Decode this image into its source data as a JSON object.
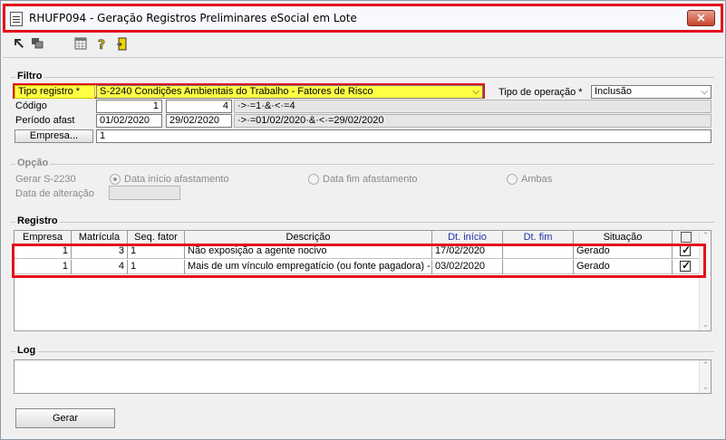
{
  "window": {
    "title": "RHUFP094 - Geração Registros Preliminares eSocial em Lote",
    "close_label": "✕"
  },
  "toolbar": {
    "icons": [
      "arrow-up-left-icon",
      "windows-icon",
      "calendar-grid-icon",
      "help-icon",
      "exit-door-icon"
    ]
  },
  "filtro": {
    "title": "Filtro",
    "tipo_registro_label": "Tipo registro *",
    "tipo_registro_value": "S-2240 Condições Ambientais do Trabalho - Fatores de Risco",
    "tipo_operacao_label": "Tipo de operação *",
    "tipo_operacao_value": "Inclusão",
    "codigo_label": "Código",
    "codigo_from": "1",
    "codigo_to": "4",
    "codigo_expr": "·>·=1·&·<·=4",
    "periodo_label": "Período afast",
    "periodo_from": "01/02/2020",
    "periodo_to": "29/02/2020",
    "periodo_expr": "·>·=01/02/2020·&·<·=29/02/2020",
    "empresa_button": "Empresa...",
    "empresa_value": "1"
  },
  "opcao": {
    "title": "Opção",
    "gerar_label": "Gerar S-2230",
    "radio_inicio": "Data início afastamento",
    "radio_fim": "Data fim afastamento",
    "radio_ambas": "Ambas",
    "data_alteracao_label": "Data de alteração",
    "data_alteracao_value": ""
  },
  "registro": {
    "title": "Registro",
    "columns": [
      "Empresa",
      "Matrícula",
      "Seq. fator",
      "Descrição",
      "Dt. início",
      "Dt. fim",
      "Situação"
    ],
    "rows": [
      {
        "empresa": "1",
        "matricula": "3",
        "seq": "1",
        "descricao": "Não exposição a agente nocivo",
        "dt_inicio": "17/02/2020",
        "dt_fim": "",
        "situacao": "Gerado",
        "checked": true
      },
      {
        "empresa": "1",
        "matricula": "4",
        "seq": "1",
        "descricao": "Mais de um vínculo empregatício (ou fonte pagadora) - N",
        "dt_inicio": "03/02/2020",
        "dt_fim": "",
        "situacao": "Gerado",
        "checked": true
      }
    ]
  },
  "log": {
    "title": "Log",
    "text": ""
  },
  "actions": {
    "gerar_label": "Gerar"
  },
  "colors": {
    "highlight": "#e3111b",
    "required_field": "#ffff44",
    "header_blue_text": "#2233aa"
  }
}
